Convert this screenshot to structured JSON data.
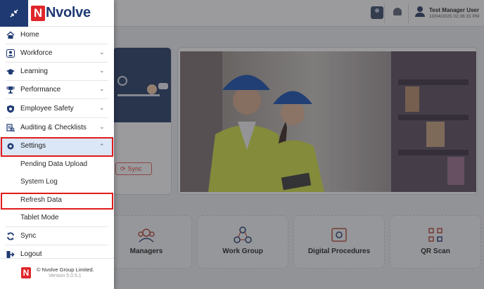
{
  "topbar": {
    "user_name": "Test Manager User",
    "user_datetime": "10/04/2025 02:36:15 PM",
    "icons": [
      "contact-card-icon",
      "bell-icon",
      "user-icon"
    ]
  },
  "background": {
    "sync_button_label": "Sync",
    "tiles": [
      {
        "label": "Managers",
        "icon": "managers-icon"
      },
      {
        "label": "Work Group",
        "icon": "work-group-icon"
      },
      {
        "label": "Digital Procedures",
        "icon": "digital-procedures-icon"
      },
      {
        "label": "QR Scan",
        "icon": "qr-scan-icon"
      }
    ]
  },
  "menu": {
    "logo_letter": "N",
    "logo_text": "Nvolve",
    "items": [
      {
        "label": "Home",
        "icon": "home-icon",
        "expandable": false
      },
      {
        "label": "Workforce",
        "icon": "workforce-icon",
        "expandable": true
      },
      {
        "label": "Learning",
        "icon": "graduation-cap-icon",
        "expandable": true
      },
      {
        "label": "Performance",
        "icon": "trophy-icon",
        "expandable": true
      },
      {
        "label": "Employee Safety",
        "icon": "shield-icon",
        "expandable": true
      },
      {
        "label": "Auditing & Checklists",
        "icon": "checklist-icon",
        "expandable": true
      },
      {
        "label": "Settings",
        "icon": "settings-icon",
        "expandable": true,
        "expanded": true
      }
    ],
    "sub_items": [
      {
        "label": "Pending Data Upload"
      },
      {
        "label": "System Log"
      },
      {
        "label": "Refresh Data"
      },
      {
        "label": "Tablet Mode"
      }
    ],
    "bottom_items": [
      {
        "label": "Sync",
        "icon": "sync-icon"
      },
      {
        "label": "Logout",
        "icon": "logout-icon"
      }
    ],
    "footer": {
      "logo_letter": "N",
      "copyright": "© Nvolve Group Limited.",
      "version": "Version 5.0.5.1"
    }
  },
  "colors": {
    "brand_navy": "#1f3a73",
    "brand_red": "#e0262b",
    "highlight_red": "#e01b1b",
    "active_item_bg": "#dbe6f6"
  }
}
